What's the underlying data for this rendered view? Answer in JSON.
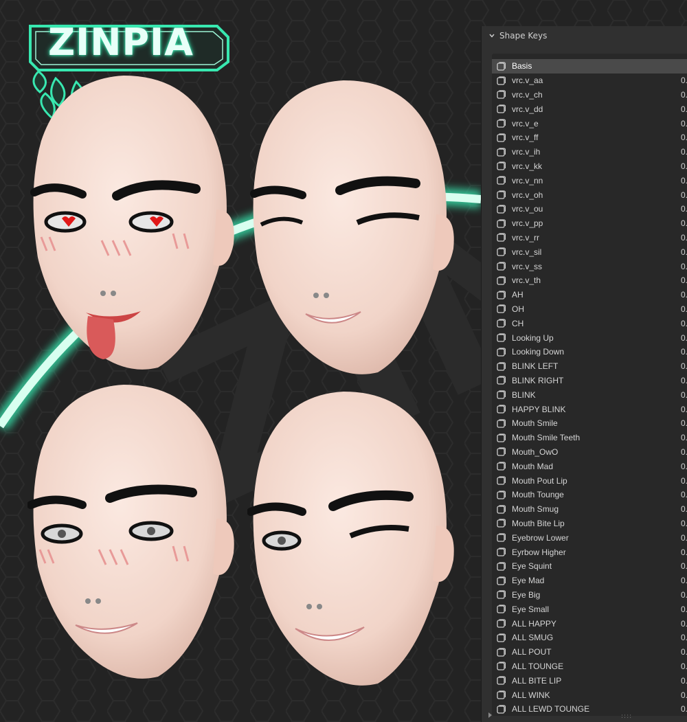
{
  "logo": {
    "text": "ZINPIA",
    "glow_color": "#38e8b0"
  },
  "panel": {
    "title": "Shape Keys",
    "rows": [
      {
        "name": "Basis",
        "value": ""
      },
      {
        "name": "vrc.v_aa",
        "value": "0."
      },
      {
        "name": "vrc.v_ch",
        "value": "0."
      },
      {
        "name": "vrc.v_dd",
        "value": "0."
      },
      {
        "name": "vrc.v_e",
        "value": "0."
      },
      {
        "name": "vrc.v_ff",
        "value": "0."
      },
      {
        "name": "vrc.v_ih",
        "value": "0."
      },
      {
        "name": "vrc.v_kk",
        "value": "0."
      },
      {
        "name": "vrc.v_nn",
        "value": "0."
      },
      {
        "name": "vrc.v_oh",
        "value": "0."
      },
      {
        "name": "vrc.v_ou",
        "value": "0."
      },
      {
        "name": "vrc.v_pp",
        "value": "0."
      },
      {
        "name": "vrc.v_rr",
        "value": "0."
      },
      {
        "name": "vrc.v_sil",
        "value": "0."
      },
      {
        "name": "vrc.v_ss",
        "value": "0."
      },
      {
        "name": "vrc.v_th",
        "value": "0."
      },
      {
        "name": "AH",
        "value": "0."
      },
      {
        "name": "OH",
        "value": "0."
      },
      {
        "name": "CH",
        "value": "0."
      },
      {
        "name": "Looking Up",
        "value": "0."
      },
      {
        "name": "Looking Down",
        "value": "0."
      },
      {
        "name": "BLINK LEFT",
        "value": "0."
      },
      {
        "name": "BLINK RIGHT",
        "value": "0."
      },
      {
        "name": "BLINK",
        "value": "0."
      },
      {
        "name": "HAPPY BLINK",
        "value": "0."
      },
      {
        "name": "Mouth Smile",
        "value": "0."
      },
      {
        "name": "Mouth Smile Teeth",
        "value": "0."
      },
      {
        "name": "Mouth_OwO",
        "value": "0."
      },
      {
        "name": "Mouth Mad",
        "value": "0."
      },
      {
        "name": "Mouth Pout Lip",
        "value": "0."
      },
      {
        "name": "Mouth Tounge",
        "value": "0."
      },
      {
        "name": "Mouth Smug",
        "value": "0."
      },
      {
        "name": "Mouth Bite Lip",
        "value": "0."
      },
      {
        "name": "Eyebrow Lower",
        "value": "0."
      },
      {
        "name": "Eyrbow Higher",
        "value": "0."
      },
      {
        "name": "Eye Squint",
        "value": "0."
      },
      {
        "name": "Eye Mad",
        "value": "0."
      },
      {
        "name": "Eye Big",
        "value": "0."
      },
      {
        "name": "Eye Small",
        "value": "0."
      },
      {
        "name": "ALL HAPPY",
        "value": "0."
      },
      {
        "name": "ALL SMUG",
        "value": "0."
      },
      {
        "name": "ALL POUT",
        "value": "0."
      },
      {
        "name": "ALL TOUNGE",
        "value": "0."
      },
      {
        "name": "ALL BITE LIP",
        "value": "0."
      },
      {
        "name": "ALL WINK",
        "value": "0."
      },
      {
        "name": "ALL LEWD TOUNGE",
        "value": "0."
      }
    ],
    "active_index": 0,
    "grip": "::::"
  },
  "colors": {
    "skin": "#f2d9cf",
    "panel_bg": "#303030",
    "list_bg": "#282828",
    "active_row": "#4a4a4a",
    "accent_glow": "#38e8b0"
  }
}
